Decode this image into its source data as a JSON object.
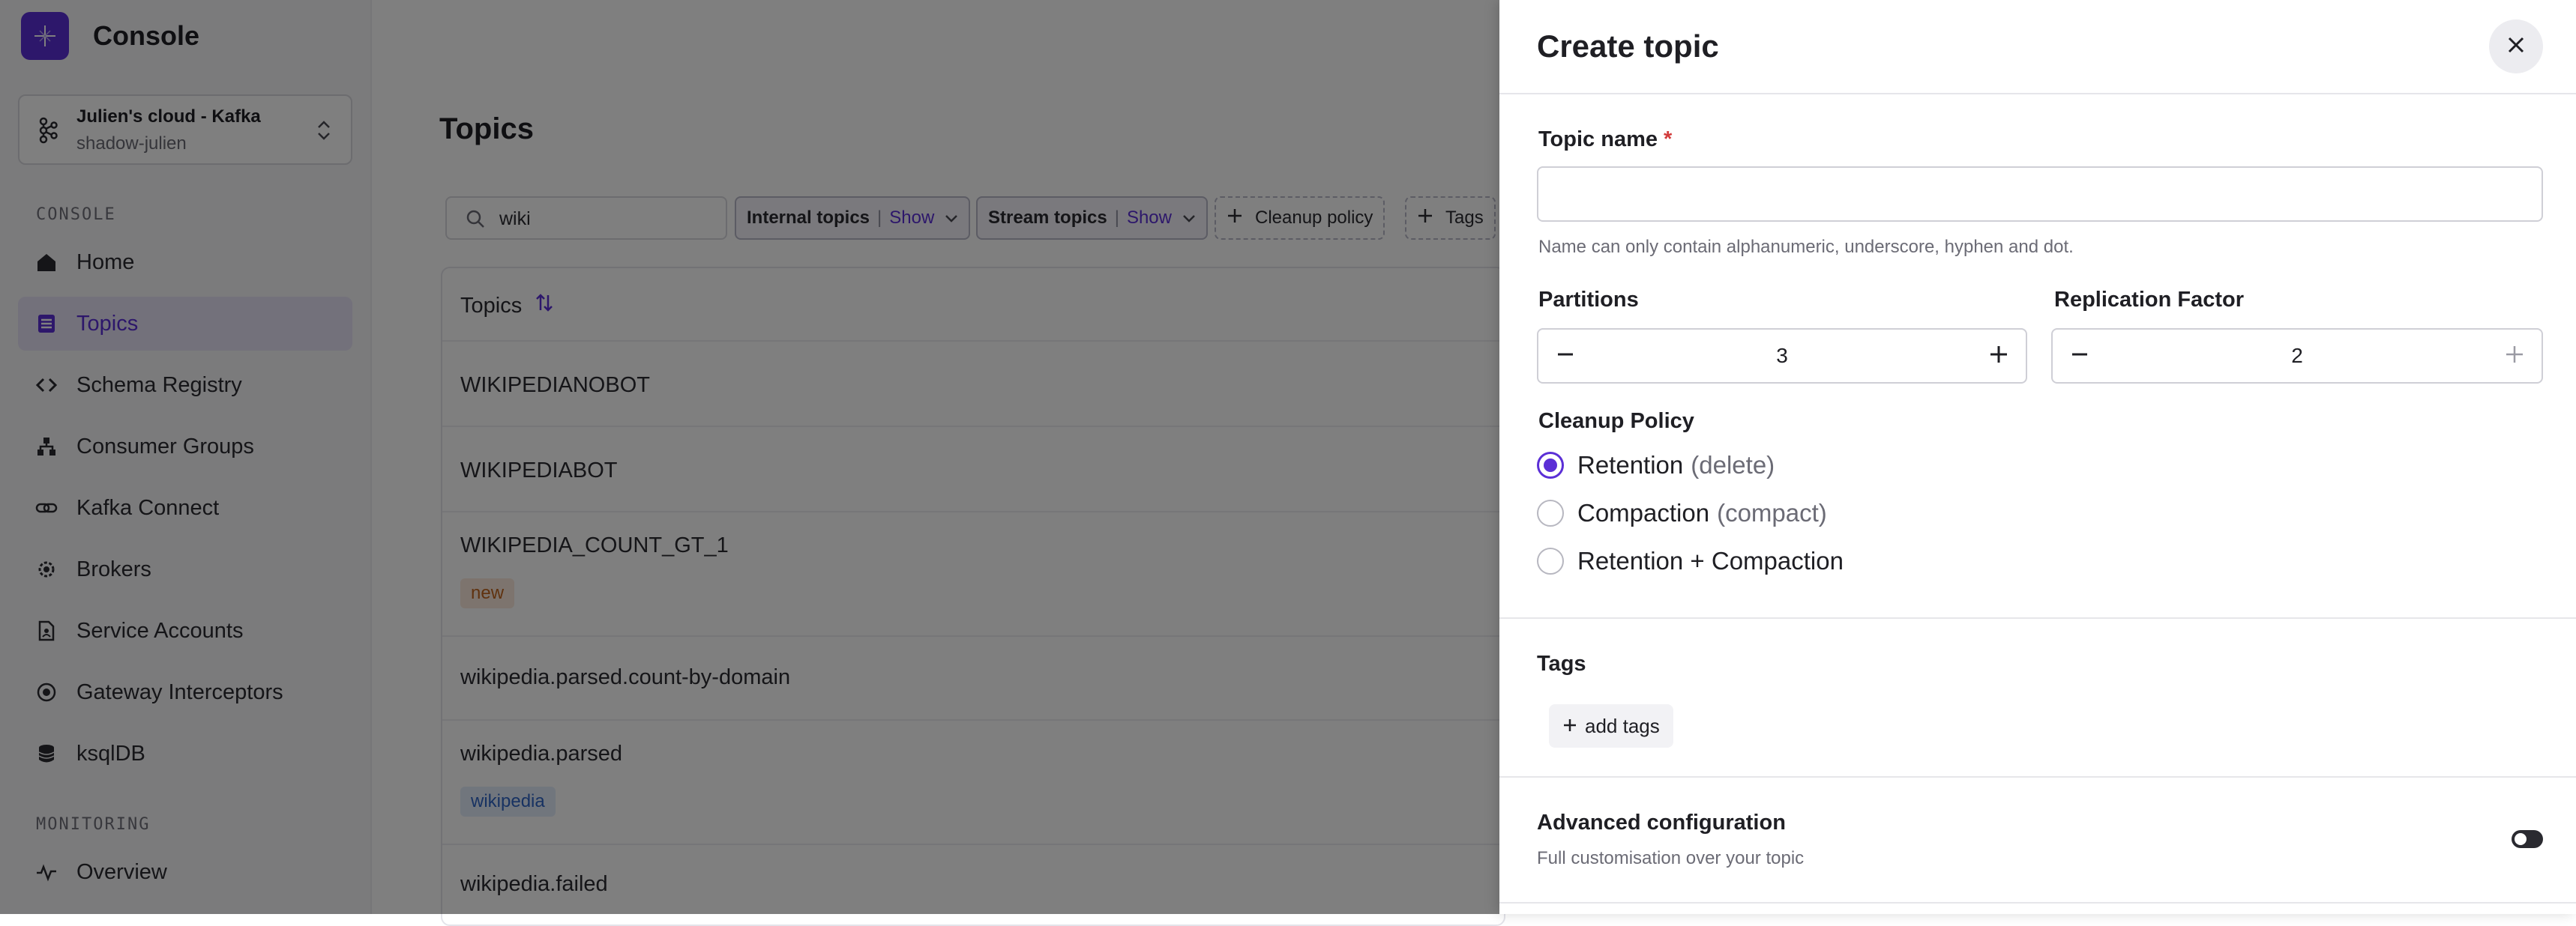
{
  "app": {
    "name": "Console",
    "cluster": {
      "name": "Julien's cloud - Kafka",
      "sub": "shadow-julien"
    }
  },
  "sidebar": {
    "section_console": "CONSOLE",
    "section_monitoring": "MONITORING",
    "items": [
      {
        "label": "Home",
        "icon": "home-icon"
      },
      {
        "label": "Topics",
        "icon": "topics-icon",
        "active": true
      },
      {
        "label": "Schema Registry",
        "icon": "code-icon"
      },
      {
        "label": "Consumer Groups",
        "icon": "groups-icon"
      },
      {
        "label": "Kafka Connect",
        "icon": "connect-icon"
      },
      {
        "label": "Brokers",
        "icon": "broker-gear-icon"
      },
      {
        "label": "Service Accounts",
        "icon": "service-account-icon"
      },
      {
        "label": "Gateway Interceptors",
        "icon": "gateway-icon"
      },
      {
        "label": "ksqlDB",
        "icon": "database-icon"
      }
    ],
    "monitoring_items": [
      {
        "label": "Overview",
        "icon": "activity-icon"
      }
    ]
  },
  "main": {
    "title": "Topics",
    "search": {
      "value": "wiki"
    },
    "filters": {
      "internal": {
        "label": "Internal topics",
        "value": "Show"
      },
      "stream": {
        "label": "Stream topics",
        "value": "Show"
      },
      "cleanup": {
        "label": "Cleanup policy"
      },
      "tags": {
        "label": "Tags"
      }
    },
    "table": {
      "header": "Topics",
      "rows": [
        {
          "name": "WIKIPEDIANOBOT"
        },
        {
          "name": "WIKIPEDIABOT"
        },
        {
          "name": "WIKIPEDIA_COUNT_GT_1",
          "tag": "new"
        },
        {
          "name": "wikipedia.parsed.count-by-domain"
        },
        {
          "name": "wikipedia.parsed",
          "tag": "wikipedia"
        },
        {
          "name": "wikipedia.failed"
        }
      ]
    }
  },
  "drawer": {
    "title": "Create topic",
    "topic_name": {
      "label": "Topic name",
      "required_mark": "*",
      "value": "",
      "hint": "Name can only contain alphanumeric, underscore, hyphen and dot."
    },
    "partitions": {
      "label": "Partitions",
      "value": "3"
    },
    "replication": {
      "label": "Replication Factor",
      "value": "2"
    },
    "cleanup": {
      "label": "Cleanup Policy",
      "options": [
        {
          "label": "Retention",
          "hint": "(delete)",
          "checked": true
        },
        {
          "label": "Compaction",
          "hint": "(compact)",
          "checked": false
        },
        {
          "label": "Retention + Compaction",
          "hint": "",
          "checked": false
        }
      ]
    },
    "tags": {
      "label": "Tags",
      "add_label": "add tags"
    },
    "advanced": {
      "title": "Advanced configuration",
      "subtitle": "Full customisation over your topic",
      "enabled": false
    }
  },
  "colors": {
    "accent": "#5b2fd6",
    "overlay": "rgba(0,0,0,0.5)",
    "required": "#d23b3b"
  }
}
